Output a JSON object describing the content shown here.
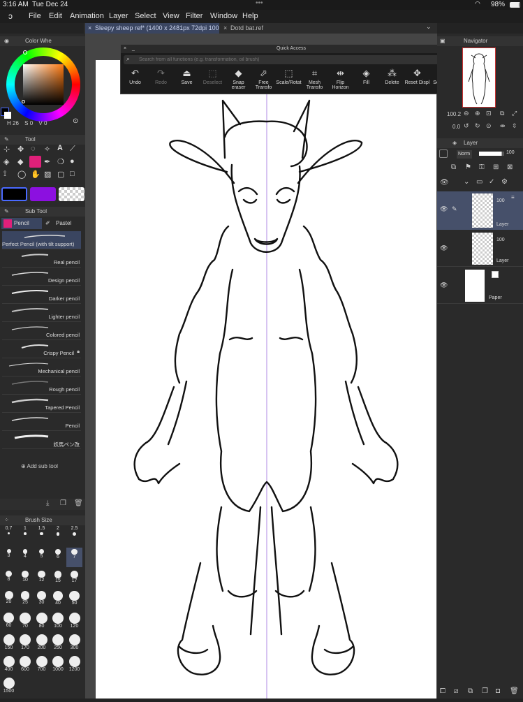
{
  "status": {
    "time": "3:16 AM",
    "date": "Tue Dec 24",
    "battery": "98%",
    "dots": "•••"
  },
  "menu": [
    "File",
    "Edit",
    "Animation",
    "Layer",
    "Select",
    "View",
    "Filter",
    "Window",
    "Help"
  ],
  "tabs": [
    {
      "label": "Sleepy sheep ref* (1400 x 2481px 72dpi 100.2%)",
      "active": true
    },
    {
      "label": "Dotd bat.ref",
      "active": false
    }
  ],
  "color_panel": {
    "title": "Color Whe",
    "values": {
      "h": "26",
      "s": "S",
      "s_val": "0",
      "v": "V",
      "v_val": "0"
    }
  },
  "tool_panel": {
    "title": "Tool"
  },
  "subtool_panel": {
    "title": "Sub Tool",
    "tabs": [
      "Pencil",
      "Pastel"
    ],
    "items": [
      "Perfect Pencil (with tilt support)",
      "Real pencil",
      "Design pencil",
      "Darker pencil",
      "Lighter pencil",
      "Colored pencil",
      "Crispy Pencil",
      "Mechanical pencil",
      "Rough pencil",
      "Tapered Pencil",
      "Pencil",
      "妖馬ペン改"
    ],
    "add_label": "Add sub tool"
  },
  "brush_size_panel": {
    "title": "Brush Size",
    "sizes": [
      "0.7",
      "1",
      "1.5",
      "2",
      "2.5",
      "3",
      "4",
      "5",
      "6",
      "7",
      "8",
      "10",
      "12",
      "15",
      "17",
      "20",
      "25",
      "30",
      "40",
      "50",
      "60",
      "70",
      "80",
      "100",
      "120",
      "150",
      "170",
      "200",
      "250",
      "300",
      "400",
      "600",
      "700",
      "1000",
      "1200",
      "1500"
    ],
    "selected": "7"
  },
  "quick_access": {
    "title": "Quick Access",
    "search_placeholder": "Search from all functions (e.g. transformation, oil brush)",
    "buttons": [
      "Undo",
      "Redo",
      "Save",
      "Deselect",
      "Snap eraser",
      "Free Transfo",
      "Scale/Rotat",
      "Mesh Transfo",
      "Flip Horizon",
      "Fill",
      "Delete",
      "Reset Displ",
      "See New Fe"
    ]
  },
  "navigator": {
    "title": "Navigator",
    "zoom": "100.2",
    "angle": "0.0"
  },
  "layer_panel": {
    "title": "Layer",
    "blend_mode": "Norm",
    "opacity": "100",
    "layers": [
      {
        "name": "Layer",
        "opacity": "100",
        "selected": true
      },
      {
        "name": "Layer",
        "opacity": "100",
        "selected": false
      },
      {
        "name": "Paper",
        "opacity": "",
        "selected": false
      }
    ]
  },
  "colors": {
    "accent": "#e0207a",
    "wheel_fg": "#c06020",
    "swatch_purple": "#8c10e0",
    "selected_layer": "#46506a"
  }
}
